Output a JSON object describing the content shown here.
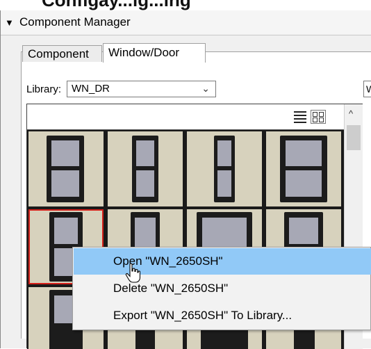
{
  "heading_fragment": "Configáy...ig...ing",
  "panel": {
    "title": "Component Manager",
    "collapse_glyph": "▼"
  },
  "tabs": [
    {
      "label": "Component"
    },
    {
      "label": "Window/Door"
    }
  ],
  "library": {
    "label": "Library:",
    "value": "WN_DR",
    "dropdown_icon": "chevron-down-icon"
  },
  "right_field": {
    "value": "W"
  },
  "view_toggle": {
    "list_icon": "list-view-icon",
    "grid_icon": "grid-view-icon",
    "active": "grid"
  },
  "context_menu": {
    "items": [
      {
        "label": "Open \"WN_2650SH\"",
        "hovered": true
      },
      {
        "label": "Delete \"WN_2650SH\""
      },
      {
        "label": "Export \"WN_2650SH\" To Library..."
      }
    ]
  },
  "colors": {
    "thumbnail_bg": "#d7d2bd",
    "window_frame": "#1c1c1c",
    "window_glass": "#a7a8b5",
    "selection": "#d4201a",
    "menu_highlight": "#91c9f7"
  }
}
